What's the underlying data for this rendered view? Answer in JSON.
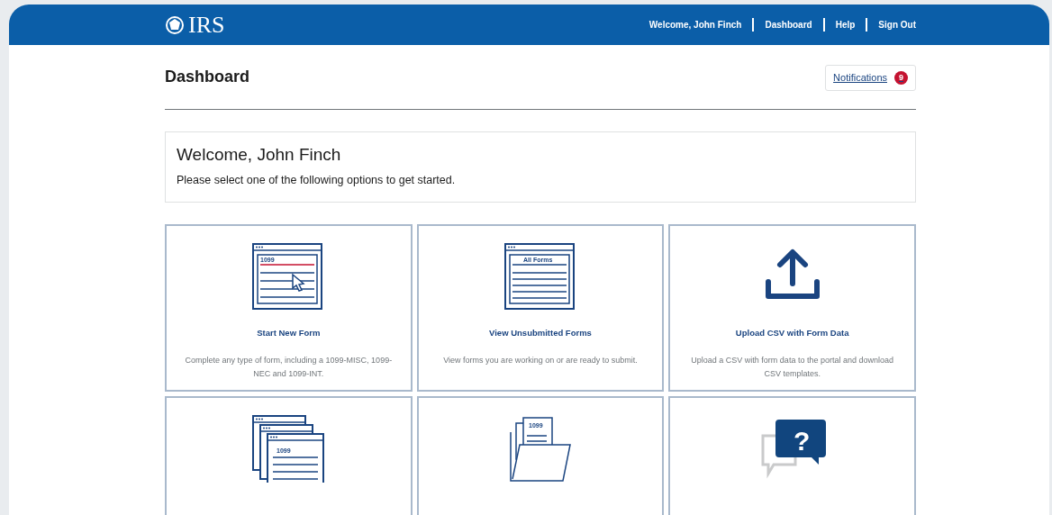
{
  "header": {
    "logo": "IRS",
    "nav": [
      "Welcome, John Finch",
      "Dashboard",
      "Help",
      "Sign Out"
    ]
  },
  "page_title": "Dashboard",
  "notifications": {
    "label": "Notifications",
    "count": "9"
  },
  "welcome": {
    "title": "Welcome, John Finch",
    "subtitle": "Please select one of the following options to get started."
  },
  "cards": [
    {
      "kind": "form-window",
      "icon_text": "1099",
      "title": "Start New Form",
      "description": "Complete any type of form, including a 1099-MISC, 1099-NEC and 1099-INT."
    },
    {
      "kind": "form-list",
      "icon_text": "All Forms",
      "title": "View Unsubmitted Forms",
      "description": "View forms you are working on or are ready to submit."
    },
    {
      "kind": "upload",
      "title": "Upload CSV with Form Data",
      "description": "Upload a CSV with form data to the portal and download CSV templates."
    },
    {
      "kind": "stacked-windows",
      "icon_text": "1099"
    },
    {
      "kind": "folder",
      "icon_text": "1099"
    },
    {
      "kind": "help-chat",
      "icon_text": "?"
    }
  ]
}
